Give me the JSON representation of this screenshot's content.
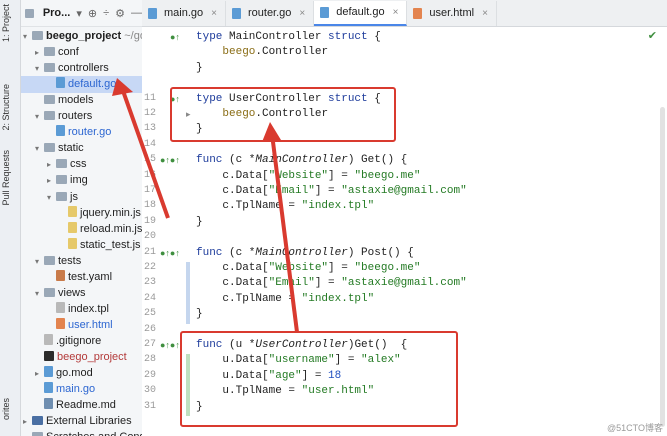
{
  "side_strip": {
    "project_label": "1: Project",
    "structure_label": "2: Structure",
    "pull_requests_label": "Pull Requests",
    "favorites_label": "orites"
  },
  "project_panel": {
    "title": "Pro..."
  },
  "tree": [
    {
      "label": "beego_project",
      "suffix": " ~/go/",
      "icon": "folder-icon",
      "arrow": "▾",
      "indent": 0,
      "bold": true
    },
    {
      "label": "conf",
      "icon": "folder-icon",
      "arrow": "▸",
      "indent": 1
    },
    {
      "label": "controllers",
      "icon": "folder-icon",
      "arrow": "▾",
      "indent": 1
    },
    {
      "label": "default.go",
      "icon": "go-file-icon",
      "arrow": "",
      "indent": 2,
      "selected": true,
      "color": "blue"
    },
    {
      "label": "models",
      "icon": "folder-icon",
      "arrow": "",
      "indent": 1
    },
    {
      "label": "routers",
      "icon": "folder-icon",
      "arrow": "▾",
      "indent": 1
    },
    {
      "label": "router.go",
      "icon": "go-file-icon",
      "arrow": "",
      "indent": 2,
      "color": "blue"
    },
    {
      "label": "static",
      "icon": "folder-icon",
      "arrow": "▾",
      "indent": 1
    },
    {
      "label": "css",
      "icon": "folder-icon",
      "arrow": "▸",
      "indent": 2
    },
    {
      "label": "img",
      "icon": "folder-icon",
      "arrow": "▸",
      "indent": 2
    },
    {
      "label": "js",
      "icon": "folder-icon",
      "arrow": "▾",
      "indent": 2
    },
    {
      "label": "jquery.min.js",
      "icon": "js-file-icon",
      "arrow": "",
      "indent": 3
    },
    {
      "label": "reload.min.js",
      "icon": "js-file-icon",
      "arrow": "",
      "indent": 3
    },
    {
      "label": "static_test.js",
      "icon": "js-file-icon",
      "arrow": "",
      "indent": 3
    },
    {
      "label": "tests",
      "icon": "folder-icon",
      "arrow": "▾",
      "indent": 1
    },
    {
      "label": "test.yaml",
      "icon": "yaml-file-icon",
      "arrow": "",
      "indent": 2
    },
    {
      "label": "views",
      "icon": "folder-icon",
      "arrow": "▾",
      "indent": 1
    },
    {
      "label": "index.tpl",
      "icon": "file-icon",
      "arrow": "",
      "indent": 2
    },
    {
      "label": "user.html",
      "icon": "html-file-icon",
      "arrow": "",
      "indent": 2,
      "color": "blue"
    },
    {
      "label": ".gitignore",
      "icon": "gitignore-file-icon",
      "arrow": "",
      "indent": 1
    },
    {
      "label": "beego_project",
      "icon": "executable-file-icon",
      "arrow": "",
      "indent": 1,
      "color": "red"
    },
    {
      "label": "go.mod",
      "icon": "gomod-file-icon",
      "arrow": "▸",
      "indent": 1
    },
    {
      "label": "main.go",
      "icon": "go-file-icon",
      "arrow": "",
      "indent": 1,
      "color": "blue"
    },
    {
      "label": "Readme.md",
      "icon": "md-file-icon",
      "arrow": "",
      "indent": 1
    },
    {
      "label": "External Libraries",
      "icon": "library-icon",
      "arrow": "▸",
      "indent": 0
    },
    {
      "label": "Scratches and Conso",
      "icon": "scratches-icon",
      "arrow": "",
      "indent": 0
    }
  ],
  "tabs": [
    {
      "label": "main.go",
      "icon": "go-file-icon"
    },
    {
      "label": "router.go",
      "icon": "go-file-icon"
    },
    {
      "label": "default.go",
      "icon": "go-file-icon",
      "active": true
    },
    {
      "label": "user.html",
      "icon": "html-file-icon"
    }
  ],
  "code_lines": [
    {
      "n": "",
      "html": "<span class=\"kw\">type</span> MainController <span class=\"kw\">struct</span> {"
    },
    {
      "n": "",
      "html": "    <span class=\"pk\">beego</span>.<span class=\"ty\">Controller</span>"
    },
    {
      "n": "",
      "html": "}"
    },
    {
      "n": "",
      "html": ""
    },
    {
      "n": "11",
      "html": "<span class=\"kw\">type</span> UserController <span class=\"kw\">struct</span> {"
    },
    {
      "n": "12",
      "html": "    <span class=\"pk\">beego</span>.<span class=\"ty\">Controller</span>"
    },
    {
      "n": "13",
      "html": "}"
    },
    {
      "n": "14",
      "html": ""
    },
    {
      "n": "15",
      "html": "<span class=\"kw\">func</span> (c *<span class=\"ital\">MainController</span>) <span class=\"fn\">Get</span>() {"
    },
    {
      "n": "16",
      "html": "    c.Data[<span class=\"str\">\"Website\"</span>] = <span class=\"str\">\"beego.me\"</span>"
    },
    {
      "n": "17",
      "html": "    c.Data[<span class=\"str\">\"Email\"</span>] = <span class=\"str\">\"astaxie@gmail.com\"</span>"
    },
    {
      "n": "18",
      "html": "    c.TplName = <span class=\"str\">\"index.tpl\"</span>"
    },
    {
      "n": "19",
      "html": "}"
    },
    {
      "n": "20",
      "html": ""
    },
    {
      "n": "21",
      "html": "<span class=\"kw\">func</span> (c *<span class=\"ital\">MainController</span>) <span class=\"fn\">Post</span>() {"
    },
    {
      "n": "22",
      "html": "    c.Data[<span class=\"str\">\"Website\"</span>] = <span class=\"str\">\"beego.me\"</span>"
    },
    {
      "n": "23",
      "html": "    c.Data[<span class=\"str\">\"Email\"</span>] = <span class=\"str\">\"astaxie@gmail.com\"</span>"
    },
    {
      "n": "24",
      "html": "    c.TplName = <span class=\"str\">\"index.tpl\"</span>"
    },
    {
      "n": "25",
      "html": "}"
    },
    {
      "n": "26",
      "html": ""
    },
    {
      "n": "27",
      "html": "<span class=\"kw\">func</span> (u *<span class=\"ital\">UserController</span>)<span class=\"fn\">Get</span>()  {"
    },
    {
      "n": "28",
      "html": "    u.Data[<span class=\"str\">\"username\"</span>] = <span class=\"str\">\"alex\"</span>"
    },
    {
      "n": "29",
      "html": "    u.Data[<span class=\"str\">\"age\"</span>] = <span class=\"num\">18</span>"
    },
    {
      "n": "30",
      "html": "    u.TplName = <span class=\"str\">\"user.html\"</span>"
    },
    {
      "n": "31",
      "html": "}"
    }
  ],
  "watermark": "@51CTO博客"
}
